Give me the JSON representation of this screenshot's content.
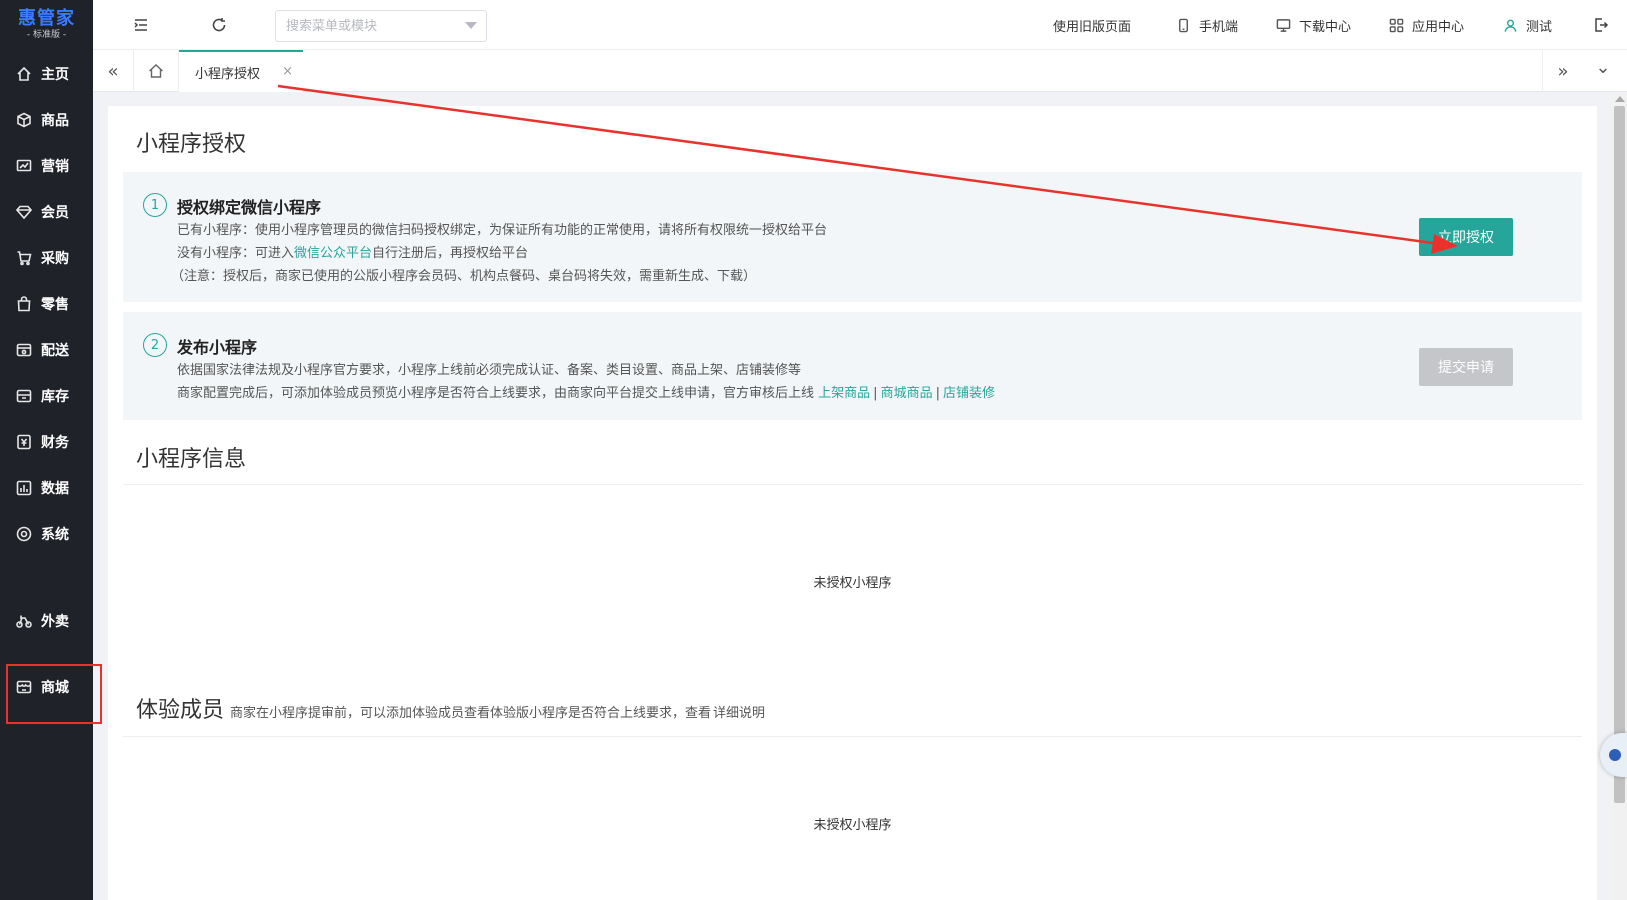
{
  "sidebar": {
    "logo_main": "惠管家",
    "logo_sub": "- 标准版 -",
    "items": [
      {
        "label": "主页",
        "icon": "home-icon"
      },
      {
        "label": "商品",
        "icon": "box-icon"
      },
      {
        "label": "营销",
        "icon": "chart-icon"
      },
      {
        "label": "会员",
        "icon": "diamond-icon"
      },
      {
        "label": "采购",
        "icon": "cart-icon"
      },
      {
        "label": "零售",
        "icon": "bag-icon"
      },
      {
        "label": "配送",
        "icon": "delivery-icon"
      },
      {
        "label": "库存",
        "icon": "inventory-icon"
      },
      {
        "label": "财务",
        "icon": "finance-icon"
      },
      {
        "label": "数据",
        "icon": "bar-chart-icon"
      },
      {
        "label": "系统",
        "icon": "settings-icon"
      },
      {
        "label": "外卖",
        "icon": "bike-icon"
      },
      {
        "label": "商城",
        "icon": "store-icon"
      }
    ]
  },
  "header": {
    "search_placeholder": "搜索菜单或模块",
    "links": {
      "old_version": "使用旧版页面",
      "mobile": "手机端",
      "download": "下载中心",
      "apps": "应用中心",
      "user": "测试"
    }
  },
  "tabs": {
    "active": "小程序授权",
    "close": "×",
    "collapse_left": "«",
    "expand_right": "»",
    "more": "⌄"
  },
  "page": {
    "title": "小程序授权",
    "step1": {
      "num": "1",
      "title": "授权绑定微信小程序",
      "line1": "已有小程序：使用小程序管理员的微信扫码授权绑定，为保证所有功能的正常使用，请将所有权限统一授权给平台",
      "line2_prefix": "没有小程序：可进入",
      "line2_link": "微信公众平台",
      "line2_suffix": "自行注册后，再授权给平台",
      "line3": "（注意：授权后，商家已使用的公版小程序会员码、机构点餐码、桌台码将失效，需重新生成、下载）",
      "button": "立即授权"
    },
    "step2": {
      "num": "2",
      "title": "发布小程序",
      "line1": "依据国家法律法规及小程序官方要求，小程序上线前必须完成认证、备案、类目设置、商品上架、店铺装修等",
      "line2_prefix": "商家配置完成后，可添加体验成员预览小程序是否符合上线要求，由商家向平台提交上线申请，官方审核后上线",
      "link_a": "上架商品",
      "link_b": "商城商品",
      "link_c": "店铺装修",
      "sep": "|",
      "button": "提交申请"
    },
    "info": {
      "title": "小程序信息",
      "empty": "未授权小程序"
    },
    "members": {
      "title": "体验成员",
      "desc": "商家在小程序提审前，可以添加体验成员查看体验版小程序是否符合上线要求，查看",
      "link": "详细说明",
      "empty": "未授权小程序"
    }
  },
  "colors": {
    "accent": "#26a69a",
    "sidebar_bg": "#1f2229",
    "annotation": "#e8332c"
  }
}
